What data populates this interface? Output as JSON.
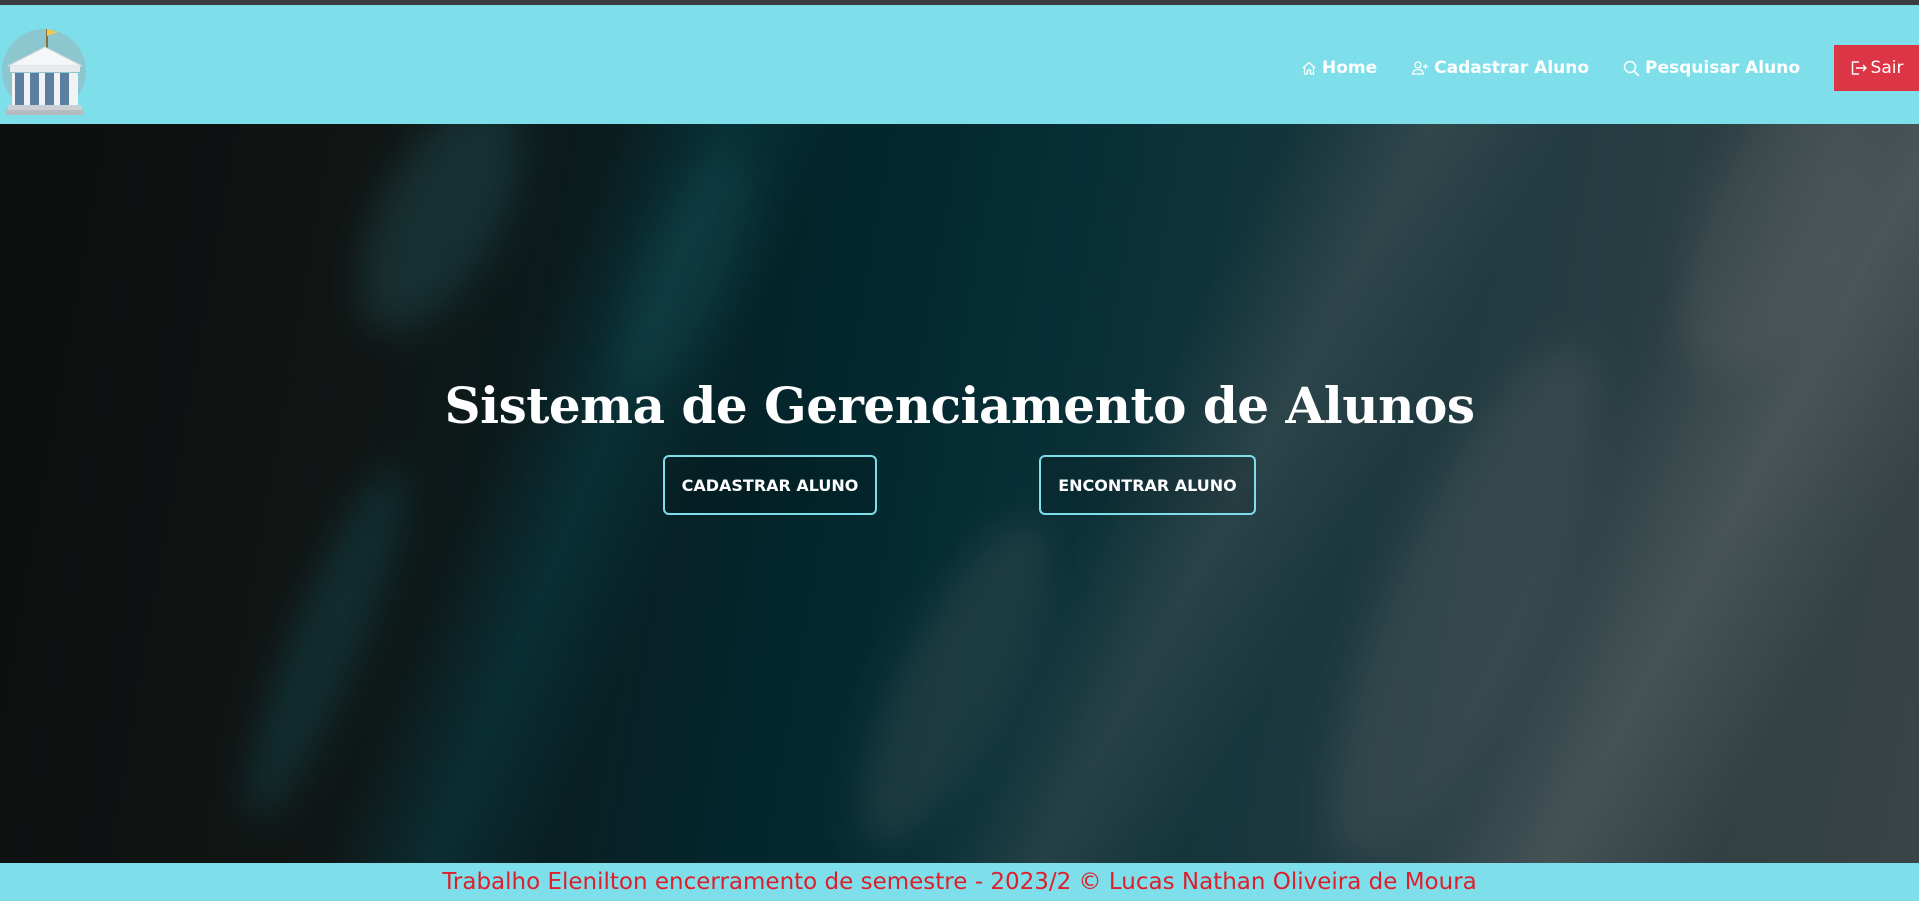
{
  "nav": {
    "logo": "bank-building-logo",
    "home_label": "Home",
    "home_icon": "house-icon",
    "cadastrar_label": "Cadastrar Aluno",
    "cadastrar_icon": "person-plus-icon",
    "pesquisar_label": "Pesquisar Aluno",
    "pesquisar_icon": "search-icon",
    "sair_label": "Sair",
    "sair_icon": "logout-icon"
  },
  "hero": {
    "title": "Sistema de Gerenciamento de Alunos",
    "btn_cadastrar": "CADASTRAR ALUNO",
    "btn_encontrar": "ENCONTRAR ALUNO"
  },
  "footer": {
    "text": "Trabalho Elenilton encerramento de semestre - 2023/2 © Lucas Nathan Oliveira de Moura"
  },
  "colors": {
    "navbar_bg": "#7edfeb",
    "danger": "#dc3545",
    "footer_text": "#dc1f2b"
  }
}
